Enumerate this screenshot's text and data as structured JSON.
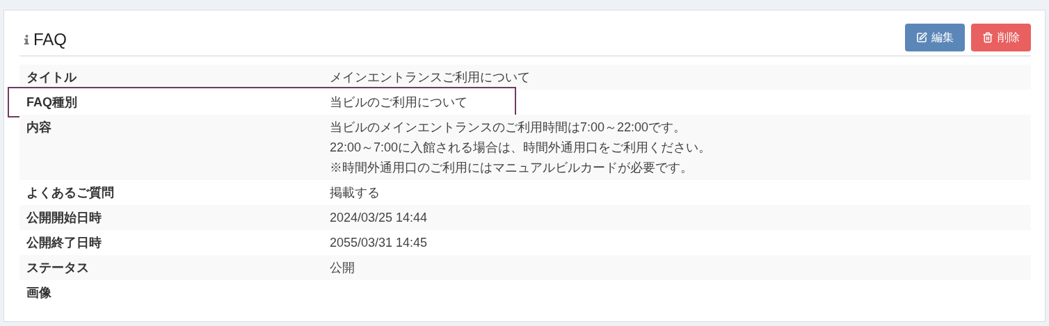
{
  "panel": {
    "title": "FAQ"
  },
  "buttons": [
    {
      "kind": "edit",
      "label": "編集"
    },
    {
      "kind": "delete",
      "label": "削除"
    }
  ],
  "rows": [
    {
      "label": "タイトル",
      "value": [
        "メインエントランスご利用について"
      ],
      "highlighted": false
    },
    {
      "label": "FAQ種別",
      "value": [
        "当ビルのご利用について"
      ],
      "highlighted": true
    },
    {
      "label": "内容",
      "value": [
        "当ビルのメインエントランスのご利用時間は7:00～22:00です。",
        "22:00～7:00に入館される場合は、時間外通用口をご利用ください。",
        "※時間外通用口のご利用にはマニュアルビルカードが必要です。"
      ],
      "highlighted": false
    },
    {
      "label": "よくあるご質問",
      "value": [
        "掲載する"
      ],
      "highlighted": false
    },
    {
      "label": "公開開始日時",
      "value": [
        "2024/03/25 14:44"
      ],
      "highlighted": false
    },
    {
      "label": "公開終了日時",
      "value": [
        "2055/03/31 14:45"
      ],
      "highlighted": false
    },
    {
      "label": "ステータス",
      "value": [
        "公開"
      ],
      "highlighted": false
    },
    {
      "label": "画像",
      "value": [],
      "highlighted": false
    }
  ]
}
